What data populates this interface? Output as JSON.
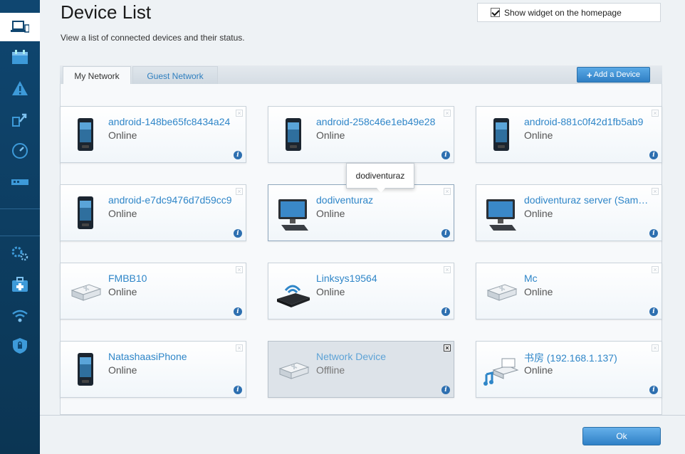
{
  "page": {
    "title": "Device List",
    "subtitle": "View a list of connected devices and their status.",
    "widget_label": "Show widget on the homepage",
    "widget_checked": true
  },
  "tabs": {
    "my_network": "My Network",
    "guest_network": "Guest Network"
  },
  "add_button": {
    "plus": "+",
    "label": "Add a Device"
  },
  "tooltip": "dodiventuraz",
  "ok_label": "Ok",
  "sidebar": [
    "device-list",
    "smart-wifi-schedule",
    "troubleshooting",
    "media-prioritization",
    "speed-test",
    "usb-storage",
    "connectivity",
    "external-storage",
    "wireless",
    "security"
  ],
  "devices": [
    {
      "name": "android-148be65fc8434a24",
      "status": "Online",
      "icon": "phone"
    },
    {
      "name": "android-258c46e1eb49e28",
      "status": "Online",
      "icon": "phone"
    },
    {
      "name": "android-881c0f42d1fb5ab9",
      "status": "Online",
      "icon": "phone"
    },
    {
      "name": "android-e7dc9476d7d59cc9",
      "status": "Online",
      "icon": "phone"
    },
    {
      "name": "dodiventuraz",
      "status": "Online",
      "icon": "desktop"
    },
    {
      "name": "dodiventuraz server (Sam…",
      "status": "Online",
      "icon": "desktop"
    },
    {
      "name": "FMBB10",
      "status": "Online",
      "icon": "storage"
    },
    {
      "name": "Linksys19564",
      "status": "Online",
      "icon": "router"
    },
    {
      "name": "Mc",
      "status": "Online",
      "icon": "storage"
    },
    {
      "name": "NatashaasiPhone",
      "status": "Online",
      "icon": "phone"
    },
    {
      "name": "Network Device",
      "status": "Offline",
      "icon": "storage"
    },
    {
      "name": "书房 (192.168.1.137)",
      "status": "Online",
      "icon": "media"
    }
  ],
  "colors": {
    "accent": "#2f86c8",
    "sidebar": "#0f4670"
  }
}
